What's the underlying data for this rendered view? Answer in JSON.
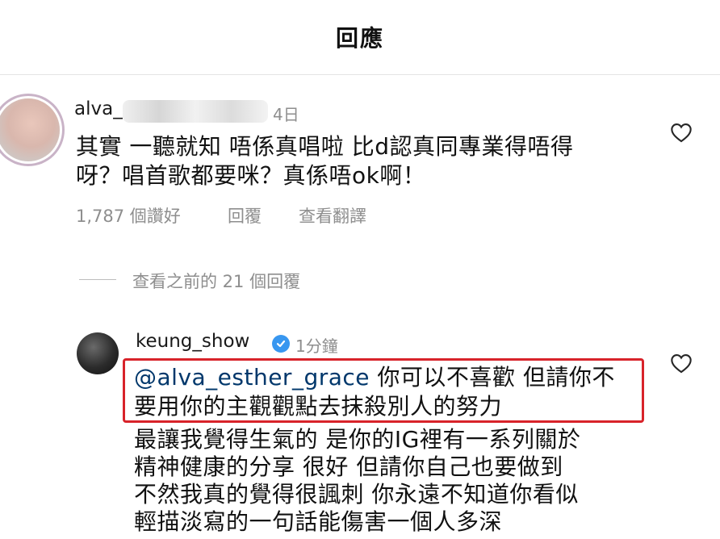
{
  "header": {
    "title": "回應"
  },
  "comment1": {
    "username": "alva_",
    "time": "4日",
    "text": "其實 一聽就知 唔係真唱啦 比d認真同專業得唔得\n呀？唱首歌都要咪？真係唔ok啊！",
    "likes": "1,787 個讚好",
    "reply_label": "回覆",
    "translate_label": "查看翻譯"
  },
  "view_previous": {
    "label": "查看之前的 21 個回覆"
  },
  "comment2": {
    "username": "keung_show",
    "time": "1分鐘",
    "mention": "@alva_esther_grace",
    "highlighted_text": " 你可以不喜歡 但請你不\n要用你的主觀觀點去抹殺別人的努力",
    "text": "最讓我覺得生氣的 是你的IG裡有一系列關於\n精神健康的分享 很好 但請你自己也要做到\n不然我真的覺得很諷刺 你永遠不知道你看似\n輕描淡寫的一句話能傷害一個人多深"
  },
  "colors": {
    "highlight_border": "#d8232a",
    "verified_badge": "#3897f0",
    "mention_link": "#00376b",
    "secondary_text": "#8e8e8e"
  }
}
